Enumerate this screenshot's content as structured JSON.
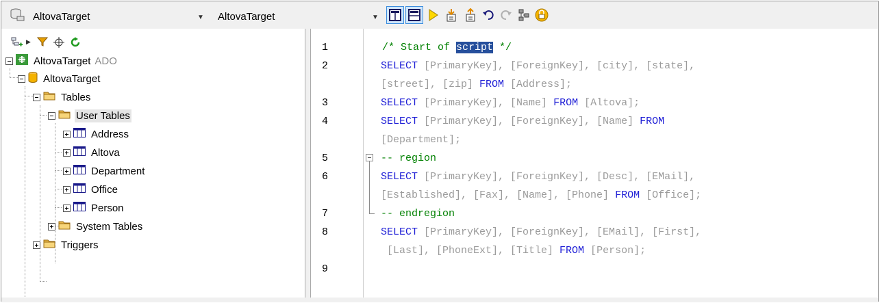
{
  "toolbar": {
    "datasource_combo": "AltovaTarget",
    "root_combo": "AltovaTarget",
    "icons": [
      "database-icon",
      "layout-editor-only-icon",
      "layout-split-icon",
      "execute-icon",
      "import-sql-icon",
      "export-sql-icon",
      "undo-icon",
      "redo-icon",
      "comment-icon",
      "lock-icon"
    ]
  },
  "browser": {
    "toolbar_icons": [
      "add-connection-icon",
      "filter-icon",
      "locate-icon",
      "refresh-icon"
    ],
    "tree": [
      {
        "label": "AltovaTarget",
        "suffix": "ADO"
      },
      {
        "label": "AltovaTarget"
      },
      {
        "label": "Tables"
      },
      {
        "label": "User Tables"
      },
      {
        "label": "Address"
      },
      {
        "label": "Altova"
      },
      {
        "label": "Department"
      },
      {
        "label": "Office"
      },
      {
        "label": "Person"
      },
      {
        "label": "System Tables"
      },
      {
        "label": "Triggers"
      }
    ]
  },
  "editor": {
    "line_numbers": [
      "1",
      "2",
      "3",
      "4",
      "5",
      "6",
      "7",
      "8",
      "9"
    ],
    "highlight_word": "script",
    "lines": {
      "l1a": "/* Start of ",
      "l1b": " */",
      "l2a": "SELECT",
      "l2b": " [PrimaryKey], [ForeignKey], [city], [state],",
      "l2c": "[street], [zip] ",
      "l2d": "FROM",
      "l2e": " [Address];",
      "l3a": "SELECT",
      "l3b": " [PrimaryKey], [Name] ",
      "l3c": "FROM",
      "l3d": " [Altova];",
      "l4a": "SELECT",
      "l4b": " [PrimaryKey], [ForeignKey], [Name] ",
      "l4c": "FROM",
      "l4d": "[Department];",
      "l5": "-- region",
      "l6a": "SELECT",
      "l6b": " [PrimaryKey], [ForeignKey], [Desc], [EMail],",
      "l6c": "[Established], [Fax], [Name], [Phone] ",
      "l6d": "FROM",
      "l6e": " [Office];",
      "l7": "-- endregion",
      "l8a": "SELECT",
      "l8b": " [PrimaryKey], [ForeignKey], [EMail], [First],",
      "l8c": " [Last], [PhoneExt], [Title] ",
      "l8d": "FROM",
      "l8e": " [Person];"
    }
  }
}
